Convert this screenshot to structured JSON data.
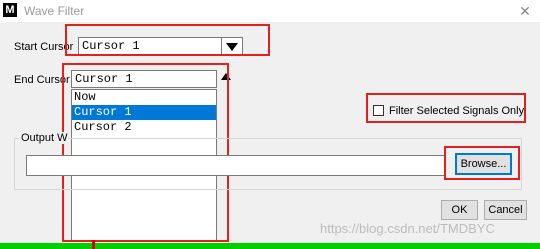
{
  "window": {
    "title": "Wave Filter",
    "app_icon_letter": "M",
    "close_glyph": "✕"
  },
  "start_cursor": {
    "label": "Start Cursor",
    "value": "Cursor 1"
  },
  "end_cursor": {
    "label": "End Cursor",
    "value": "Cursor 1",
    "options": [
      "Now",
      "Cursor 1",
      "Cursor 2"
    ],
    "selected_index": 1
  },
  "filter": {
    "label": "Filter Selected Signals Only",
    "checked": false
  },
  "output": {
    "label": "Output W",
    "path_value": "",
    "browse_label": "Browse..."
  },
  "buttons": {
    "ok": "OK",
    "cancel": "Cancel"
  },
  "watermark": "https://blog.csdn.net/TMDBYC",
  "colors": {
    "highlight": "#e2211c",
    "selection": "#0078d7",
    "timeline": "#00d000"
  }
}
